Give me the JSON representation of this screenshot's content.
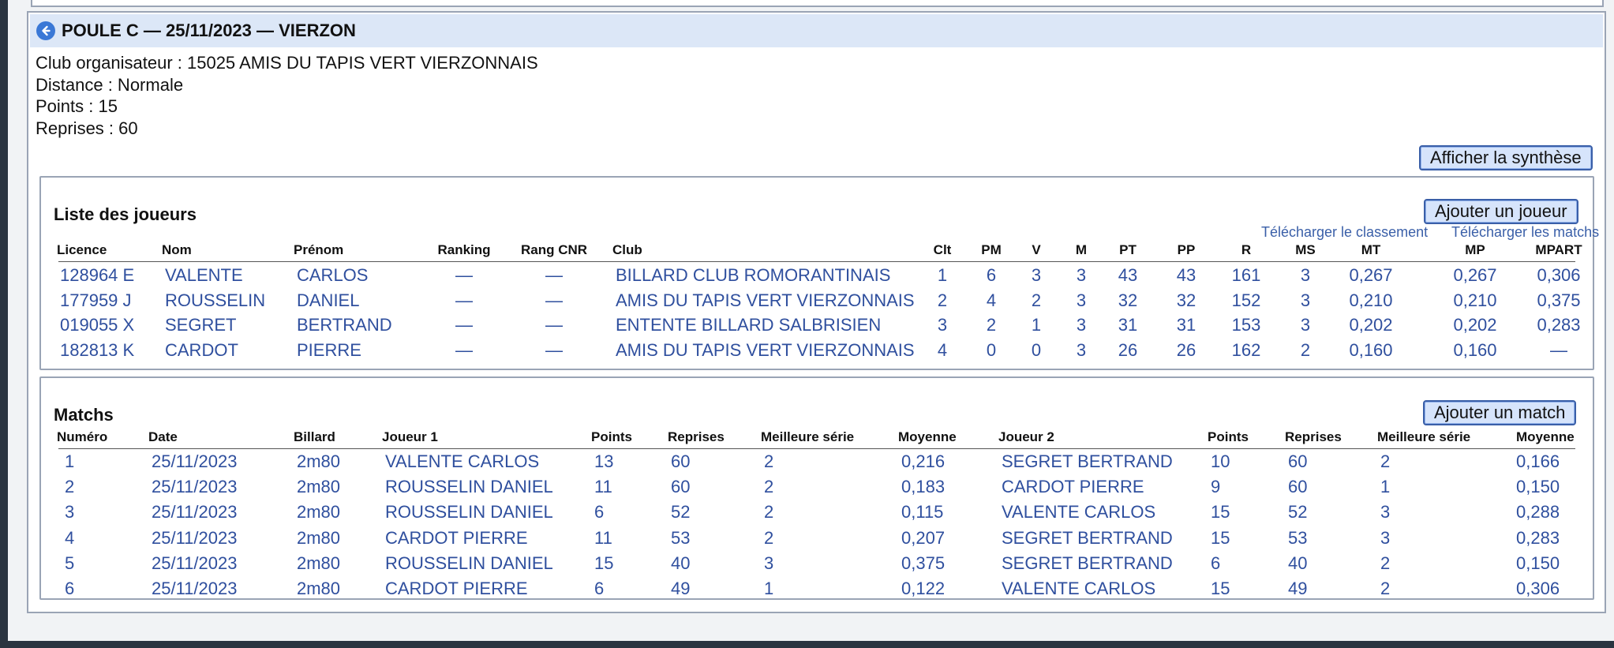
{
  "poule": {
    "title": "POULE C — 25/11/2023 — VIERZON",
    "club_organisateur": "Club organisateur : 15025 AMIS DU TAPIS VERT VIERZONNAIS",
    "distance": "Distance : Normale",
    "points": "Points : 15",
    "reprises": "Reprises : 60",
    "synthese_button": "Afficher la synthèse"
  },
  "players": {
    "title": "Liste des joueurs",
    "add_button": "Ajouter un joueur",
    "download_ranking": "Télécharger le classement",
    "download_matches": "Télécharger les matchs",
    "columns": [
      "Licence",
      "Nom",
      "Prénom",
      "Ranking",
      "Rang CNR",
      "Club",
      "Clt",
      "PM",
      "V",
      "M",
      "PT",
      "PP",
      "R",
      "MS",
      "MT",
      "MP",
      "MPART"
    ],
    "rows": [
      [
        "128964 E",
        "VALENTE",
        "CARLOS",
        "—",
        "—",
        "BILLARD CLUB ROMORANTINAIS",
        "1",
        "6",
        "3",
        "3",
        "43",
        "43",
        "161",
        "3",
        "0,267",
        "0,267",
        "0,306"
      ],
      [
        "177959 J",
        "ROUSSELIN",
        "DANIEL",
        "—",
        "—",
        "AMIS DU TAPIS VERT VIERZONNAIS",
        "2",
        "4",
        "2",
        "3",
        "32",
        "32",
        "152",
        "3",
        "0,210",
        "0,210",
        "0,375"
      ],
      [
        "019055 X",
        "SEGRET",
        "BERTRAND",
        "—",
        "—",
        "ENTENTE BILLARD SALBRISIEN",
        "3",
        "2",
        "1",
        "3",
        "31",
        "31",
        "153",
        "3",
        "0,202",
        "0,202",
        "0,283"
      ],
      [
        "182813 K",
        "CARDOT",
        "PIERRE",
        "—",
        "—",
        "AMIS DU TAPIS VERT VIERZONNAIS",
        "4",
        "0",
        "0",
        "3",
        "26",
        "26",
        "162",
        "2",
        "0,160",
        "0,160",
        "—"
      ]
    ]
  },
  "matches": {
    "title": "Matchs",
    "add_button": "Ajouter un match",
    "columns": [
      "Numéro",
      "Date",
      "Billard",
      "Joueur 1",
      "Points",
      "Reprises",
      "Meilleure série",
      "Moyenne",
      "Joueur 2",
      "Points",
      "Reprises",
      "Meilleure série",
      "Moyenne"
    ],
    "rows": [
      [
        "1",
        "25/11/2023",
        "2m80",
        "VALENTE CARLOS",
        "13",
        "60",
        "2",
        "0,216",
        "SEGRET BERTRAND",
        "10",
        "60",
        "2",
        "0,166"
      ],
      [
        "2",
        "25/11/2023",
        "2m80",
        "ROUSSELIN DANIEL",
        "11",
        "60",
        "2",
        "0,183",
        "CARDOT PIERRE",
        "9",
        "60",
        "1",
        "0,150"
      ],
      [
        "3",
        "25/11/2023",
        "2m80",
        "ROUSSELIN DANIEL",
        "6",
        "52",
        "2",
        "0,115",
        "VALENTE CARLOS",
        "15",
        "52",
        "3",
        "0,288"
      ],
      [
        "4",
        "25/11/2023",
        "2m80",
        "CARDOT PIERRE",
        "11",
        "53",
        "2",
        "0,207",
        "SEGRET BERTRAND",
        "15",
        "53",
        "3",
        "0,283"
      ],
      [
        "5",
        "25/11/2023",
        "2m80",
        "ROUSSELIN DANIEL",
        "15",
        "40",
        "3",
        "0,375",
        "SEGRET BERTRAND",
        "6",
        "40",
        "2",
        "0,150"
      ],
      [
        "6",
        "25/11/2023",
        "2m80",
        "CARDOT PIERRE",
        "6",
        "49",
        "1",
        "0,122",
        "VALENTE CARLOS",
        "15",
        "49",
        "2",
        "0,306"
      ]
    ]
  },
  "colors": {
    "accent": "#3a78d6",
    "link": "#3a5fa8",
    "header_bg": "#dce7f7",
    "button_bg": "#d6e4fb"
  },
  "icons": {
    "back": "arrow-left-circle-icon"
  }
}
